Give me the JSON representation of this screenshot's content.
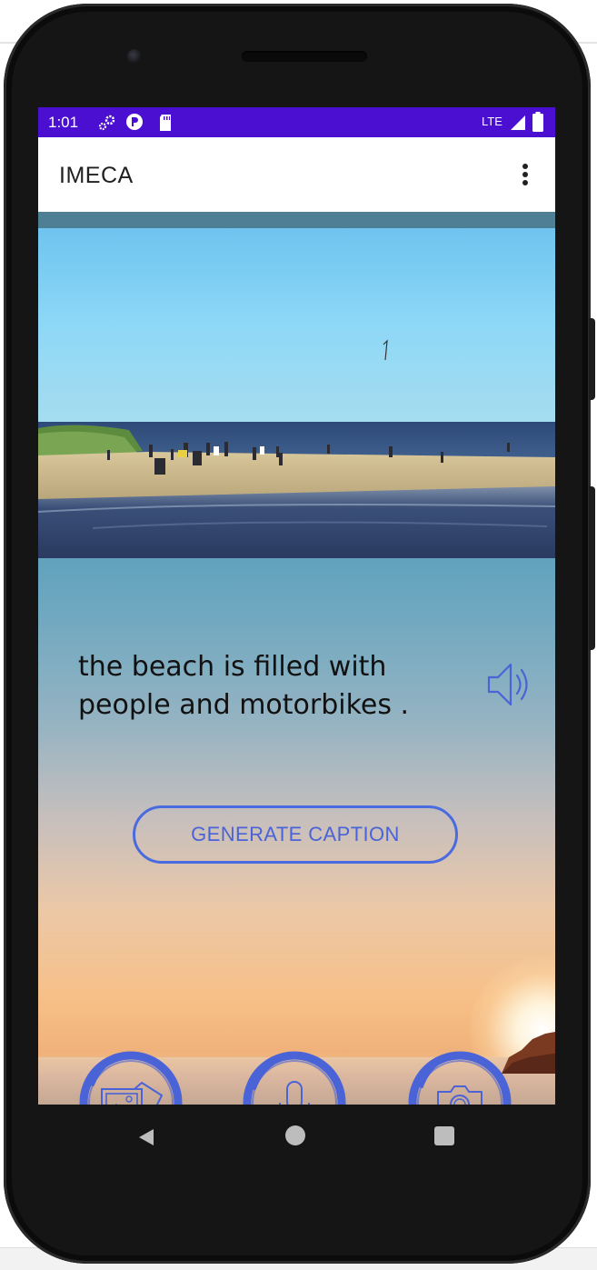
{
  "status_bar": {
    "time": "1:01",
    "network": "LTE",
    "icons": [
      "settings-gear-icon",
      "google-play-icon",
      "sd-card-icon",
      "signal-icon",
      "battery-icon"
    ],
    "color": "#4a0fd0"
  },
  "app_bar": {
    "title": "IMECA",
    "overflow_icon": "more-vert-icon"
  },
  "main": {
    "image_description_icon": "beach-photo",
    "caption": "the beach is filled with people and motorbikes .",
    "speak_icon": "speaker-icon",
    "generate_button": "GENERATE CAPTION",
    "accent_color": "#4a63d6"
  },
  "actions": [
    {
      "name": "gallery",
      "icon": "gallery-icon"
    },
    {
      "name": "microphone",
      "icon": "mic-icon"
    },
    {
      "name": "camera",
      "icon": "camera-icon"
    }
  ],
  "nav_bar": {
    "icons": [
      "back-icon",
      "home-icon",
      "recents-icon"
    ]
  }
}
